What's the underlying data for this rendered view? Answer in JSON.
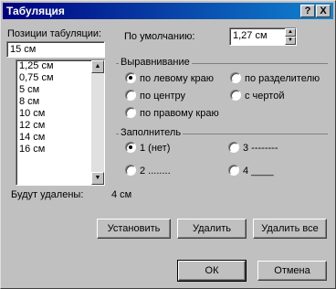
{
  "window": {
    "title": "Табуляция",
    "help_label": "?",
    "close_label": "X"
  },
  "tab_positions": {
    "label": "Позиции табуляции:",
    "value": "15 см",
    "items": [
      "1,25 см",
      "0,75 см",
      "5 см",
      "8 см",
      "10 см",
      "12 см",
      "14 см",
      "16 см"
    ]
  },
  "default": {
    "label": "По умолчанию:",
    "value": "1,27 см"
  },
  "alignment": {
    "title": "Выравнивание",
    "options": [
      {
        "label": "по левому краю",
        "selected": true
      },
      {
        "label": "по центру",
        "selected": false
      },
      {
        "label": "по правому краю",
        "selected": false
      },
      {
        "label": "по разделителю",
        "selected": false
      },
      {
        "label": "с чертой",
        "selected": false
      }
    ]
  },
  "leader": {
    "title": "Заполнитель",
    "options": [
      {
        "label": "1 (нет)",
        "selected": true
      },
      {
        "label": "2 ........",
        "selected": false
      },
      {
        "label": "3 --------",
        "selected": false
      },
      {
        "label": "4 ____",
        "selected": false
      }
    ]
  },
  "to_clear": {
    "label": "Будут удалены:",
    "value": "4 см"
  },
  "buttons": {
    "set": "Установить",
    "clear": "Удалить",
    "clear_all": "Удалить все",
    "ok": "ОК",
    "cancel": "Отмена"
  },
  "icons": {
    "scroll_up": "▲",
    "scroll_down": "▼",
    "spin_up": "▲",
    "spin_down": "▼"
  }
}
